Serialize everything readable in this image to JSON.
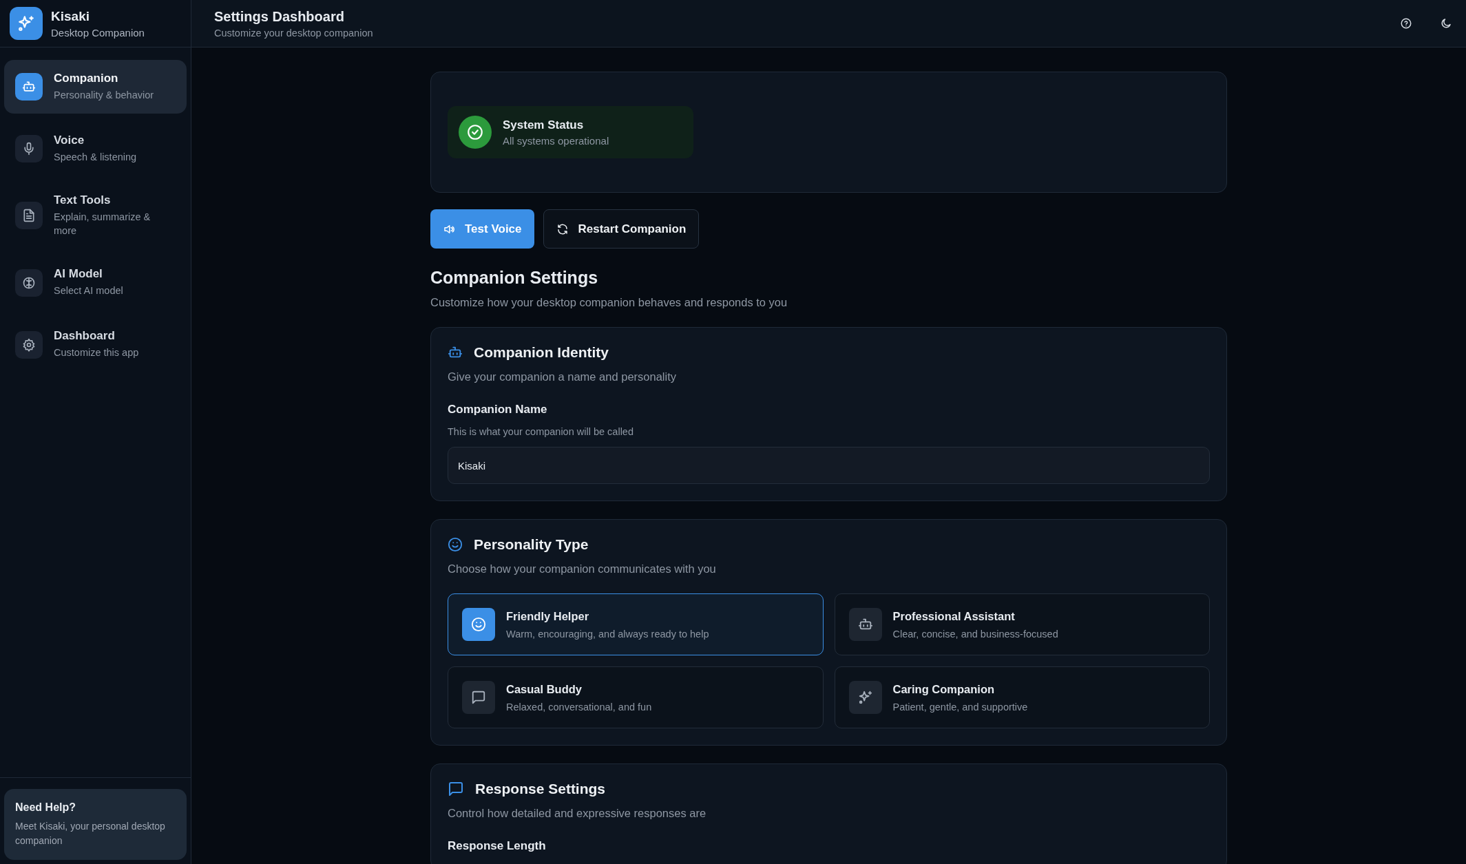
{
  "app": {
    "name": "Kisaki",
    "subtitle": "Desktop Companion"
  },
  "header": {
    "title": "Settings Dashboard",
    "subtitle": "Customize your desktop companion"
  },
  "sidebar": {
    "items": [
      {
        "label": "Companion",
        "description": "Personality & behavior",
        "selected": true
      },
      {
        "label": "Voice",
        "description": "Speech & listening",
        "selected": false
      },
      {
        "label": "Text Tools",
        "description": "Explain, summarize & more",
        "selected": false
      },
      {
        "label": "AI Model",
        "description": "Select AI model",
        "selected": false
      },
      {
        "label": "Dashboard",
        "description": "Customize this app",
        "selected": false
      }
    ],
    "help": {
      "title": "Need Help?",
      "text": "Meet Kisaki, your personal desktop companion"
    }
  },
  "status": {
    "title": "System Status",
    "text": "All systems operational"
  },
  "buttons": [
    {
      "label": "Test Voice",
      "kind": "primary"
    },
    {
      "label": "Restart Companion",
      "kind": "secondary"
    }
  ],
  "section": {
    "title": "Companion Settings",
    "subtitle": "Customize how your desktop companion behaves and responds to you"
  },
  "identity": {
    "title": "Companion Identity",
    "subtitle": "Give your companion a name and personality",
    "field_label": "Companion Name",
    "field_hint": "This is what your companion will be called",
    "value": "Kisaki"
  },
  "personality": {
    "title": "Personality Type",
    "subtitle": "Choose how your companion communicates with you",
    "options": [
      {
        "title": "Friendly Helper",
        "description": "Warm, encouraging, and always ready to help",
        "selected": true
      },
      {
        "title": "Professional Assistant",
        "description": "Clear, concise, and business-focused",
        "selected": false
      },
      {
        "title": "Casual Buddy",
        "description": "Relaxed, conversational, and fun",
        "selected": false
      },
      {
        "title": "Caring Companion",
        "description": "Patient, gentle, and supportive",
        "selected": false
      }
    ]
  },
  "response": {
    "title": "Response Settings",
    "subtitle": "Control how detailed and expressive responses are",
    "field_label": "Response Length"
  }
}
